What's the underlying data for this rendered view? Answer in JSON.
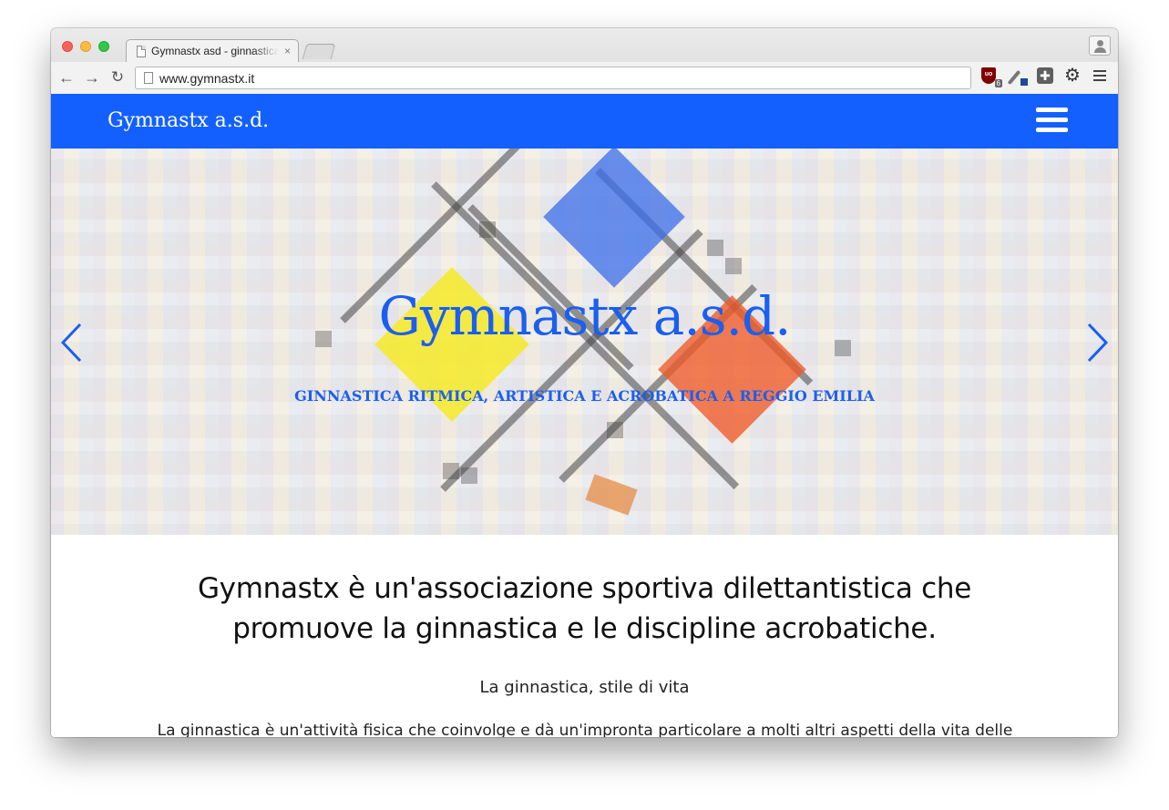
{
  "browser": {
    "tab_title": "Gymnastx asd - ginnastica",
    "tab_close": "×",
    "url": "www.gymnastx.it",
    "ublock_label": "uo",
    "ublock_badge": "6",
    "nav": {
      "back": "←",
      "forward": "→",
      "reload": "↻"
    },
    "icons": [
      "page-icon",
      "ublock-icon",
      "color-picker-icon",
      "extension-icon",
      "gear-icon",
      "menu-icon",
      "profile-icon"
    ]
  },
  "site": {
    "brand": "Gymnastx a.s.d.",
    "accent_color": "#1360ff"
  },
  "hero": {
    "title": "Gymnastx a.s.d.",
    "subtitle": "GINNASTICA RITMICA, ARTISTICA E ACROBATICA A REGGIO EMILIA",
    "title_color": "#1a5ff0"
  },
  "content": {
    "lead_line1": "Gymnastx è un'associazione sportiva dilettantistica che",
    "lead_line2": "promuove la ginnastica e le discipline acrobatiche.",
    "subhead": "La ginnastica, stile di vita",
    "paragraph": "La ginnastica è un'attività fisica che coinvolge e dà un'impronta particolare a molti altri aspetti della vita delle"
  }
}
